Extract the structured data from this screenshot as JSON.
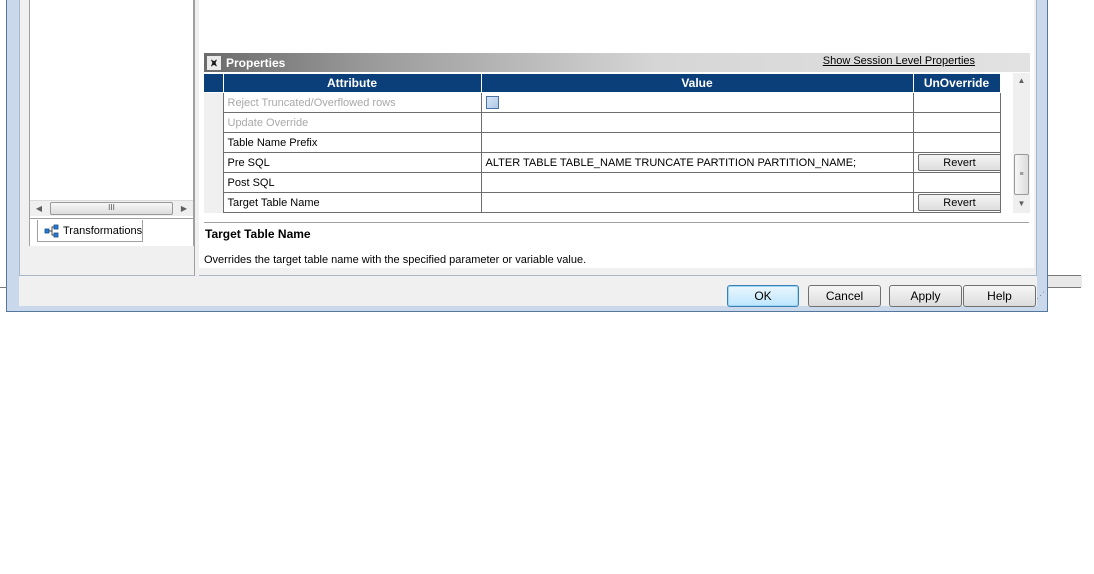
{
  "left_panel": {
    "scroll_thumb_label": "III",
    "tabs": [
      {
        "label": "Transformations",
        "icon": "transformations-icon"
      }
    ]
  },
  "properties": {
    "section_title": "Properties",
    "collapse_glyph": "⩙",
    "session_link_label": "Show Session Level Properties",
    "columns": [
      "Attribute",
      "Value",
      "UnOverride"
    ],
    "rows": [
      {
        "attribute": "Reject Truncated/Overflowed rows",
        "value": "",
        "value_type": "checkbox",
        "unoverride": "",
        "disabled": true
      },
      {
        "attribute": "Update Override",
        "value": "",
        "unoverride": "",
        "disabled": true
      },
      {
        "attribute": "Table Name Prefix",
        "value": "",
        "unoverride": ""
      },
      {
        "attribute": "Pre SQL",
        "value": "ALTER TABLE TABLE_NAME TRUNCATE PARTITION PARTITION_NAME;",
        "unoverride": "Revert"
      },
      {
        "attribute": "Post SQL",
        "value": "",
        "unoverride": ""
      },
      {
        "attribute": "Target Table Name",
        "value": "",
        "unoverride": "Revert"
      }
    ]
  },
  "description": {
    "title": "Target Table Name",
    "text": "Overrides the target table name with the specified parameter or variable value."
  },
  "buttons": {
    "ok": "OK",
    "cancel": "Cancel",
    "apply": "Apply",
    "help": "Help"
  },
  "colors": {
    "grid_header": "#0b3f79",
    "dialog_frame": "#c9d8ea"
  }
}
